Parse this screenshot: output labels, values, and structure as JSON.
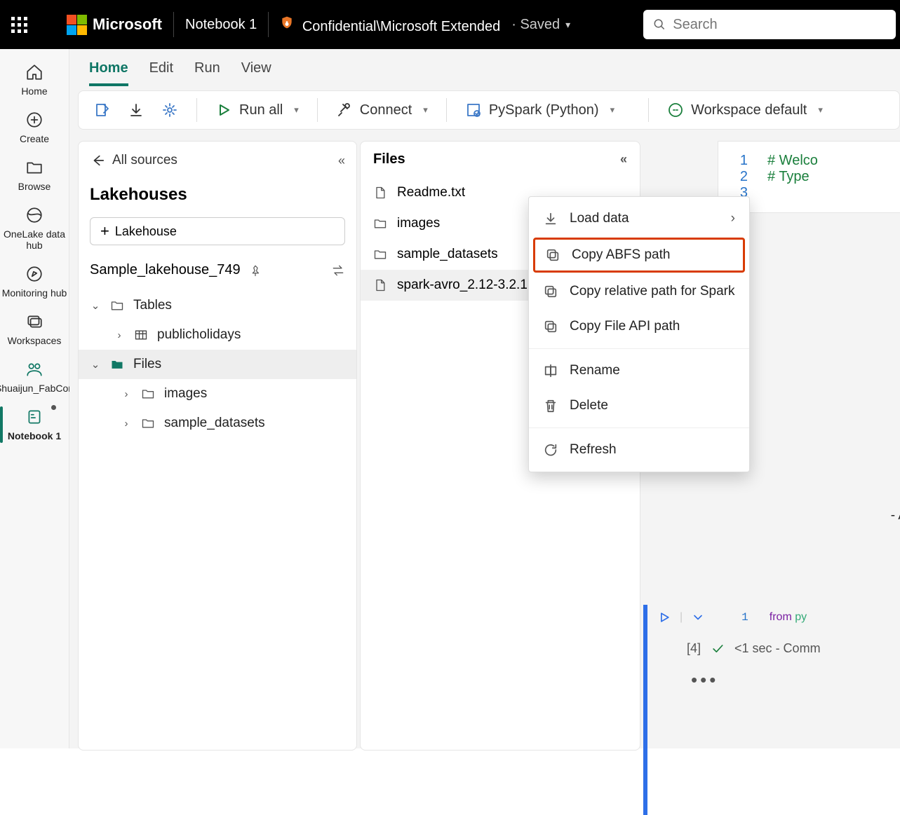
{
  "topbar": {
    "brand": "Microsoft",
    "notebook_title": "Notebook 1",
    "confidentiality": "Confidential\\Microsoft Extended",
    "save_state": "· Saved",
    "search_placeholder": "Search"
  },
  "leftrail": {
    "items": [
      {
        "label": "Home"
      },
      {
        "label": "Create"
      },
      {
        "label": "Browse"
      },
      {
        "label": "OneLake data hub"
      },
      {
        "label": "Monitoring hub"
      },
      {
        "label": "Workspaces"
      },
      {
        "label": "Shuaijun_FabCon"
      },
      {
        "label": "Notebook 1"
      }
    ]
  },
  "tabs": [
    "Home",
    "Edit",
    "Run",
    "View"
  ],
  "toolbar": {
    "run_all": "Run all",
    "connect": "Connect",
    "language": "PySpark (Python)",
    "environment": "Workspace default"
  },
  "sources_panel": {
    "back": "All sources",
    "heading": "Lakehouses",
    "add_button": "Lakehouse",
    "lakehouse_name": "Sample_lakehouse_749",
    "tree": {
      "tables": "Tables",
      "table_items": [
        "publicholidays"
      ],
      "files": "Files",
      "file_folders": [
        "images",
        "sample_datasets"
      ]
    }
  },
  "files_panel": {
    "heading": "Files",
    "items": [
      {
        "name": "Readme.txt",
        "type": "file"
      },
      {
        "name": "images",
        "type": "folder"
      },
      {
        "name": "sample_datasets",
        "type": "folder"
      },
      {
        "name": "spark-avro_2.12-3.2.1.jar",
        "type": "file"
      }
    ]
  },
  "context_menu": {
    "items": [
      {
        "label": "Load data",
        "icon": "download",
        "submenu": true
      },
      {
        "label": "Copy ABFS path",
        "icon": "copy",
        "highlight": true
      },
      {
        "label": "Copy relative path for Spark",
        "icon": "copy"
      },
      {
        "label": "Copy File API path",
        "icon": "copy"
      },
      {
        "sep": true
      },
      {
        "label": "Rename",
        "icon": "rename"
      },
      {
        "label": "Delete",
        "icon": "trash"
      },
      {
        "sep": true
      },
      {
        "label": "Refresh",
        "icon": "refresh"
      }
    ]
  },
  "code": {
    "lines": [
      "# Welco",
      "# Type ",
      ""
    ],
    "snippet_from": "from",
    "snippet_rest": " py",
    "cell_index": "[4]",
    "duration": "<1 sec",
    "status_rest": " - Comm",
    "annotation_suffix": " - A"
  }
}
